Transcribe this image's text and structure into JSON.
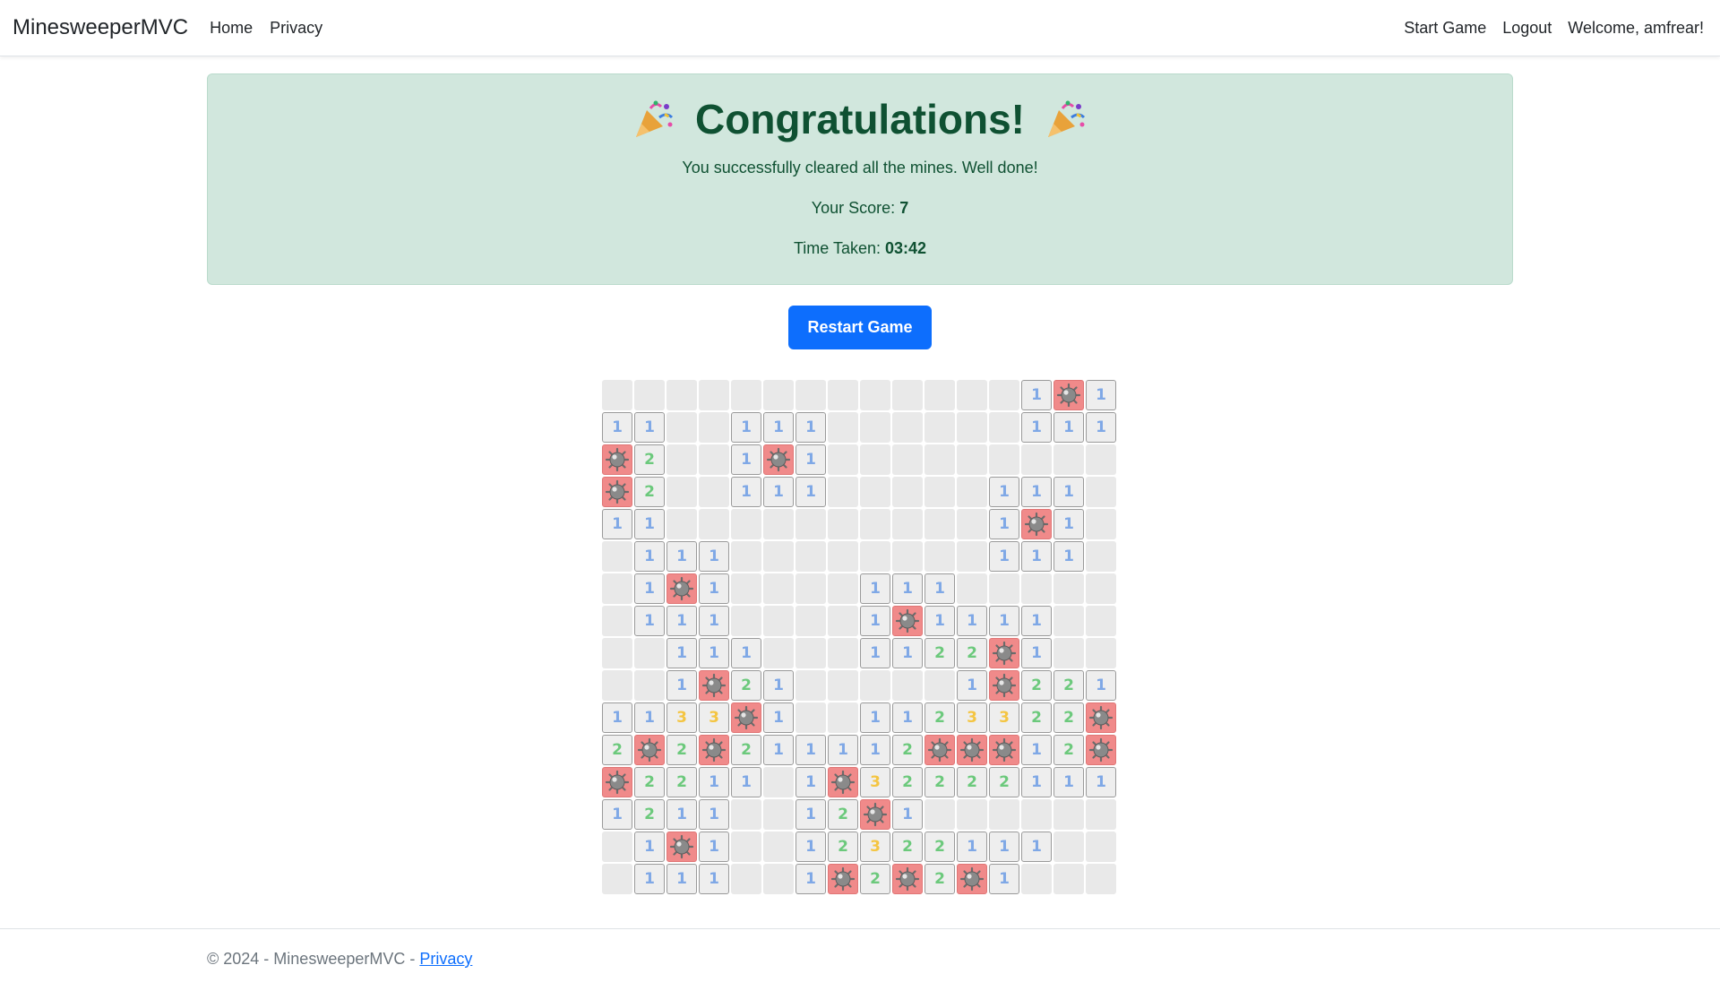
{
  "navbar": {
    "brand": "MinesweeperMVC",
    "home": "Home",
    "privacy": "Privacy",
    "start_game": "Start Game",
    "logout": "Logout",
    "welcome": "Welcome, amfrear!"
  },
  "banner": {
    "title": "Congratulations!",
    "message": "You successfully cleared all the mines. Well done!",
    "score_label": "Your Score:",
    "score_value": "7",
    "time_label": "Time Taken:",
    "time_value": "03:42"
  },
  "restart_button": "Restart Game",
  "board": {
    "legend": "cell codes: . = hidden/empty, 1-3 = revealed number, M = mine",
    "rows": [
      ".............1M1",
      "11..111......111",
      "M2..1M1.........",
      "M2..111.....111.",
      "11..........1M1.",
      ".111........111.",
      ".1M1....111.....",
      ".111....1M1111..",
      "..111...1122M1..",
      "..1M21.....1M221",
      "1133M1..1123322M",
      "2M2M211112MMM12M",
      "M2211.1M32222111",
      "1211..12M1......",
      ".1M1..12322111..",
      ".111..1M2M2M1..."
    ]
  },
  "footer": {
    "text": "© 2024 - MinesweeperMVC - ",
    "privacy_link": "Privacy"
  },
  "colors": {
    "primary": "#0d6efd",
    "success_bg": "#d1e7dd",
    "success_text": "#0f5132",
    "mine_bg": "#f08a8a",
    "num1": "#7fa8e6",
    "num2": "#6cc97c",
    "num3": "#f4c542"
  }
}
